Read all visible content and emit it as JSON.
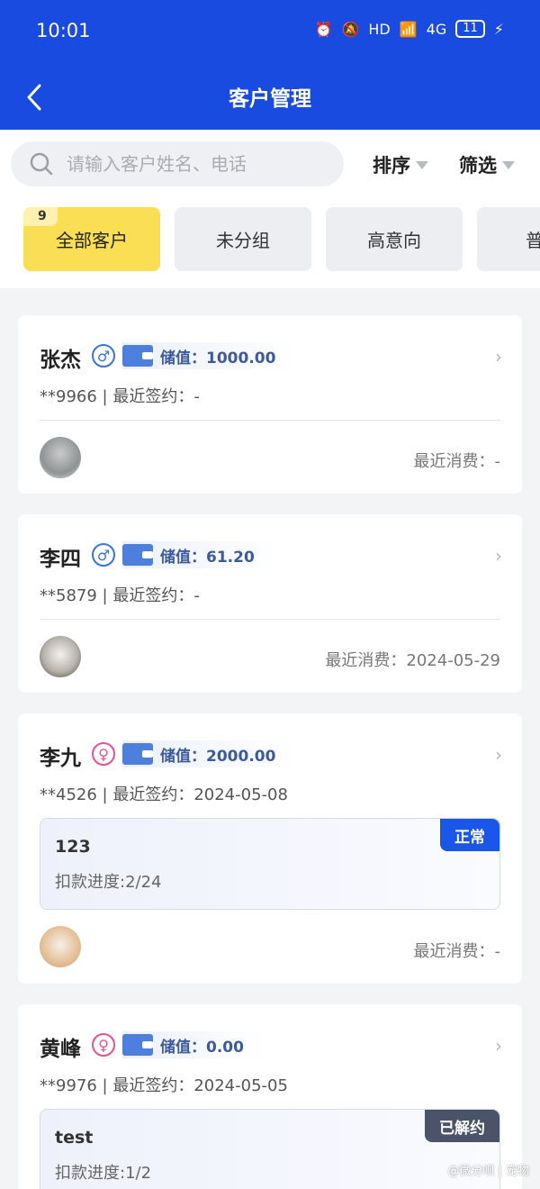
{
  "status_bar": {
    "time": "10:01",
    "network": "HD",
    "signal": "4G",
    "battery": "11"
  },
  "header": {
    "title": "客户管理"
  },
  "search": {
    "placeholder": "请输入客户姓名、电话"
  },
  "toolbar": {
    "sort_label": "排序",
    "filter_label": "筛选"
  },
  "tabs": [
    {
      "label": "全部客户",
      "count": "9",
      "active": true
    },
    {
      "label": "未分组"
    },
    {
      "label": "高意向"
    },
    {
      "label": "普"
    }
  ],
  "customers": [
    {
      "name": "张杰",
      "gender": "male",
      "gender_symbol": "♂",
      "stored_value": "储值：1000.00",
      "phone_sign": "**9966 | 最近签约：-",
      "last_spend": "最近消费：-"
    },
    {
      "name": "李四",
      "gender": "male",
      "gender_symbol": "♂",
      "stored_value": "储值：61.20",
      "phone_sign": "**5879 | 最近签约：-",
      "last_spend": "最近消费：2024-05-29"
    },
    {
      "name": "李九",
      "gender": "female",
      "gender_symbol": "♀",
      "stored_value": "储值：2000.00",
      "phone_sign": "**4526 | 最近签约：2024-05-08",
      "contract": {
        "name": "123",
        "progress": "扣款进度:2/24",
        "status": "正常"
      },
      "last_spend": "最近消费：-"
    },
    {
      "name": "黄峰",
      "gender": "female",
      "gender_symbol": "♀",
      "stored_value": "储值：0.00",
      "phone_sign": "**9976 | 最近签约：2024-05-05",
      "contract": {
        "name": "test",
        "progress": "扣款进度:1/2",
        "status": "已解约"
      }
    }
  ],
  "watermark": "@微分呗 | 宠物",
  "colors": {
    "primary": "#1a4be0",
    "active_tab": "#fadf54",
    "male": "#3b74d8",
    "female": "#e45294",
    "status_normal": "#1a56e8",
    "status_terminated": "#4a5368"
  }
}
